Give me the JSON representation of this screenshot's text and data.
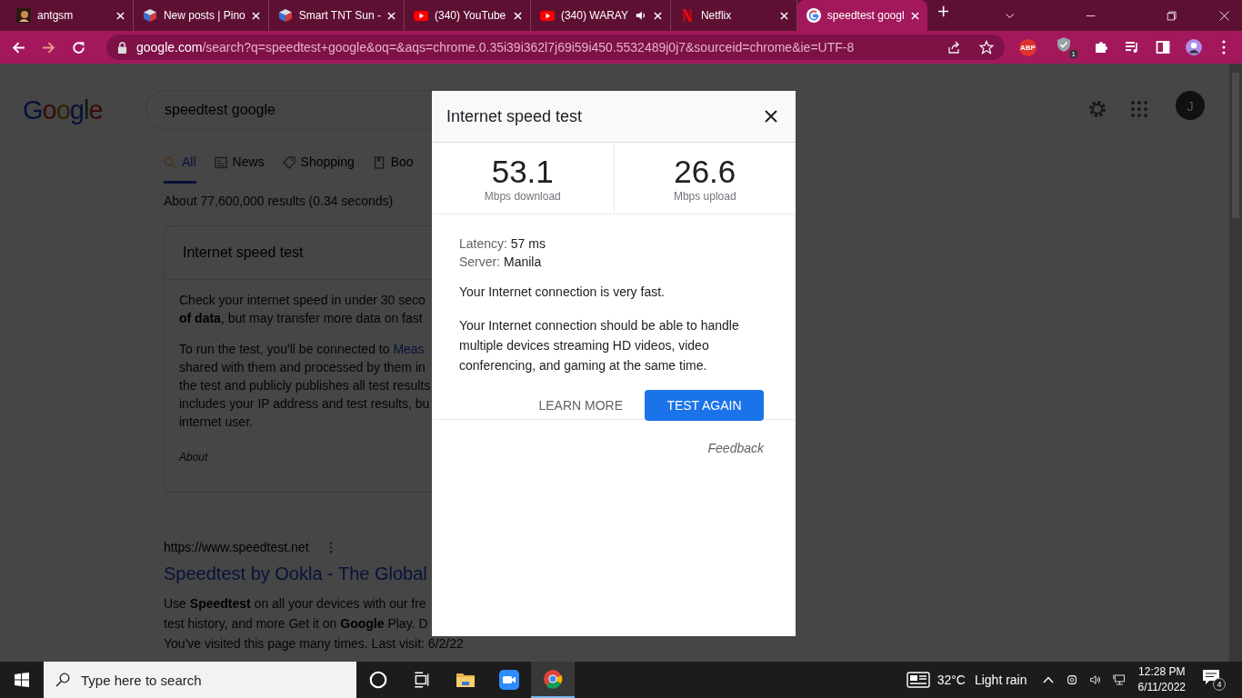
{
  "browser": {
    "tabs": [
      {
        "title": "antgsm",
        "kind": "avatar",
        "selected": false,
        "audio": false
      },
      {
        "title": "New posts | Pino",
        "kind": "cube",
        "selected": false,
        "audio": false
      },
      {
        "title": "Smart TNT Sun -",
        "kind": "cube",
        "selected": false,
        "audio": false
      },
      {
        "title": "(340) YouTube",
        "kind": "play",
        "selected": false,
        "audio": false
      },
      {
        "title": "(340) WARAY",
        "kind": "play",
        "selected": false,
        "audio": true
      },
      {
        "title": "Netflix",
        "kind": "ribbon",
        "selected": false,
        "audio": false
      },
      {
        "title": "speedtest googl",
        "kind": "g",
        "selected": true,
        "audio": false
      }
    ],
    "nav": [
      {
        "kind": "back",
        "disabled": false
      },
      {
        "kind": "forward",
        "disabled": true
      },
      {
        "kind": "reload",
        "disabled": false
      }
    ],
    "address": {
      "domain": "google.com",
      "path": "/search?q=speedtest+google&oq=&aqs=chrome.0.35i39i362l7j69i59i450.5532489j0j7&sourceid=chrome&ie=UTF-8"
    },
    "extensions": [
      {
        "kind": "abp",
        "label": "ABP"
      },
      {
        "kind": "shield",
        "badge": "1"
      },
      {
        "kind": "puzzle"
      },
      {
        "kind": "media"
      },
      {
        "kind": "sidepanel"
      },
      {
        "kind": "profile"
      },
      {
        "kind": "menu"
      }
    ]
  },
  "page": {
    "logo": "Google",
    "query": "speedtest google",
    "tabs": [
      {
        "label": "All",
        "kind": "search",
        "selected": true
      },
      {
        "label": "News",
        "kind": "news",
        "selected": false
      },
      {
        "label": "Shopping",
        "kind": "tag",
        "selected": false
      },
      {
        "label": "Boo",
        "kind": "book",
        "selected": false
      }
    ],
    "result_count": "About 77,600,000 results (0.34 seconds)",
    "card": {
      "title": "Internet speed test",
      "paragraphs": [
        {
          "lines": [
            "Check your internet speed in under 30 seco",
            "**of data**, but may transfer more data on fast"
          ]
        },
        {
          "lines": [
            "To run the test, you'll be connected to ",
            "shared with them and processed by them in",
            "the test and publicly publishes all test results",
            "includes your IP address and test results, bu",
            "internet user."
          ],
          "link": "Meas"
        }
      ],
      "about": "About"
    },
    "result": {
      "url": "https://www.speedtest.net",
      "title": "Speedtest by Ookla - The Global",
      "snippet": [
        "Use **Speedtest** on all your devices with our fre",
        "test history, and more Get it on **Google** Play. D",
        "You've visited this page many times. Last visit: 6/2/22"
      ]
    },
    "avatar": "J"
  },
  "dialog": {
    "title": "Internet speed test",
    "stats": [
      {
        "value": "53.1",
        "label": "Mbps download"
      },
      {
        "value": "26.6",
        "label": "Mbps upload"
      }
    ],
    "details": [
      {
        "label": "Latency:",
        "value": "57 ms"
      },
      {
        "label": "Server:",
        "value": "Manila"
      }
    ],
    "verdict": "Your Internet connection is very fast.",
    "explanation": "Your Internet connection should be able to handle multiple devices streaming HD videos, video conferencing, and gaming at the same time.",
    "learn_more": "LEARN MORE",
    "test_again": "TEST AGAIN",
    "feedback": "Feedback"
  },
  "taskbar": {
    "search_placeholder": "Type here to search",
    "apps": [
      {
        "kind": "cortana",
        "selected": false
      },
      {
        "kind": "taskview",
        "selected": false
      },
      {
        "kind": "folder",
        "selected": false
      },
      {
        "kind": "video",
        "selected": false
      },
      {
        "kind": "chrome",
        "selected": true
      }
    ],
    "temperature": "32°C",
    "weather": "Light rain",
    "time": "12:28 PM",
    "date": "6/11/2022",
    "notifications": "4"
  }
}
